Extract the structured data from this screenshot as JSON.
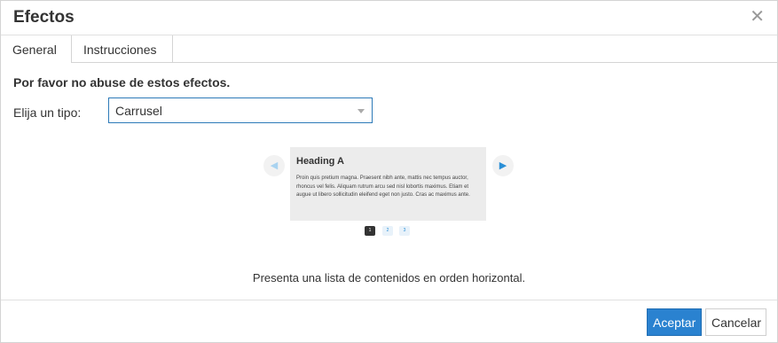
{
  "dialog": {
    "title": "Efectos",
    "close_glyph": "✕"
  },
  "tabs": [
    {
      "label": "General",
      "active": true
    },
    {
      "label": "Instrucciones",
      "active": false
    }
  ],
  "form": {
    "warning": "Por favor no abuse de estos efectos.",
    "type_label": "Elija un tipo:",
    "type_value": "Carrusel"
  },
  "preview": {
    "prev_glyph": "◀",
    "next_glyph": "▶",
    "heading": "Heading A",
    "body": "Proin quis pretium magna. Praesent nibh ante, mattis nec tempus auctor, rhoncus vel felis. Aliquam rutrum arcu sed nisl lobortis maximus. Etiam et augue ut libero sollicitudin eleifend eget non justo. Cras ac maximus ante.",
    "pages": [
      "1",
      "2",
      "3"
    ],
    "active_page": "1"
  },
  "description": "Presenta una lista de contenidos en orden horizontal.",
  "buttons": {
    "accept": "Aceptar",
    "cancel": "Cancelar"
  },
  "colors": {
    "accent": "#2a82d0",
    "select_border": "#2d7ab8"
  }
}
